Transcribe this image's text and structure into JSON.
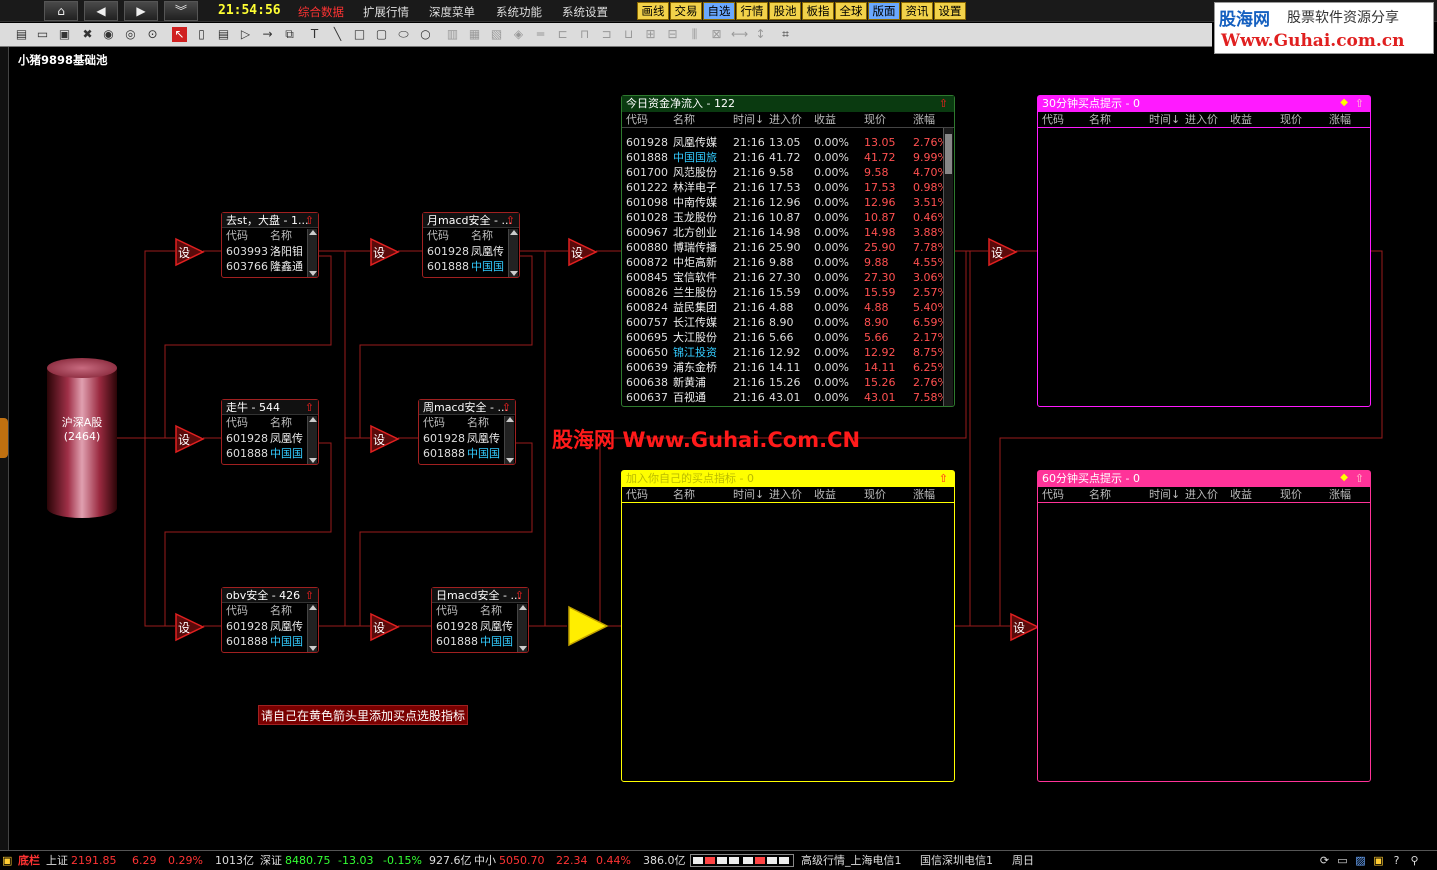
{
  "menubar": {
    "clock": "21:54:56",
    "items": [
      "综合数据",
      "扩展行情",
      "深度菜单",
      "系统功能",
      "系统设置"
    ],
    "quick": [
      "画线",
      "交易",
      "自选",
      "行情",
      "股池",
      "板指",
      "全球",
      "版面",
      "资讯",
      "设置"
    ]
  },
  "brand": {
    "line1": "股海网",
    "line1b": "股票软件资源分享",
    "line2": "Www.Guhai.com.cn"
  },
  "pool_title": "小猪9898基础池",
  "source": {
    "name": "沪深A股",
    "count": "(2464)"
  },
  "arrow_label": "设",
  "colors": {
    "wire": "#9a1c1c",
    "arrow": "#c41a1a",
    "arrow_yellow": "#ffee00",
    "panel_green_bg": "#0a3a10",
    "panel_green_border": "#2e7a2e",
    "panel_yellow": "#ffff00",
    "panel_magenta": "#ff1aff",
    "panel_pink": "#ff3399",
    "name_normal": "#eeeeee",
    "name_highlight": "#33ccff"
  },
  "filters": {
    "f1": {
      "title": "去st，大盘 - 1...",
      "cols": [
        "代码",
        "名称"
      ],
      "rows": [
        {
          "code": "603993",
          "name": "洛阳钼",
          "hl": false
        },
        {
          "code": "603766",
          "name": "隆鑫通",
          "hl": false
        }
      ]
    },
    "f2": {
      "title": "走牛 - 544",
      "cols": [
        "代码",
        "名称"
      ],
      "rows": [
        {
          "code": "601928",
          "name": "凤凰传",
          "hl": false
        },
        {
          "code": "601888",
          "name": "中国国",
          "hl": true
        }
      ]
    },
    "f3": {
      "title": "obv安全 - 426",
      "cols": [
        "代码",
        "名称"
      ],
      "rows": [
        {
          "code": "601928",
          "name": "凤凰传",
          "hl": false
        },
        {
          "code": "601888",
          "name": "中国国",
          "hl": true
        }
      ]
    },
    "f4": {
      "title": "月macd安全 - ...",
      "cols": [
        "代码",
        "名称"
      ],
      "rows": [
        {
          "code": "601928",
          "name": "凤凰传",
          "hl": false
        },
        {
          "code": "601888",
          "name": "中国国",
          "hl": true
        }
      ]
    },
    "f5": {
      "title": "周macd安全 - ...",
      "cols": [
        "代码",
        "名称"
      ],
      "rows": [
        {
          "code": "601928",
          "name": "凤凰传",
          "hl": false
        },
        {
          "code": "601888",
          "name": "中国国",
          "hl": true
        }
      ]
    },
    "f6": {
      "title": "日macd安全 - ...",
      "cols": [
        "代码",
        "名称"
      ],
      "rows": [
        {
          "code": "601928",
          "name": "凤凰传",
          "hl": false
        },
        {
          "code": "601888",
          "name": "中国国",
          "hl": true
        }
      ]
    }
  },
  "panel_cols": [
    "代码",
    "名称",
    "时间↓",
    "进入价",
    "收益",
    "现价",
    "涨幅"
  ],
  "panels": {
    "inflow": {
      "title": "今日资金净流入 - 122",
      "rows": [
        {
          "code": "601928",
          "name": "凤凰传媒",
          "time": "21:16",
          "in": "13.05",
          "ret": "0.00%",
          "now": "13.05",
          "chg": "2.76%",
          "hl": false
        },
        {
          "code": "601888",
          "name": "中国国旅",
          "time": "21:16",
          "in": "41.72",
          "ret": "0.00%",
          "now": "41.72",
          "chg": "9.99%",
          "hl": true
        },
        {
          "code": "601700",
          "name": "风范股份",
          "time": "21:16",
          "in": "9.58",
          "ret": "0.00%",
          "now": "9.58",
          "chg": "4.70%",
          "hl": false
        },
        {
          "code": "601222",
          "name": "林洋电子",
          "time": "21:16",
          "in": "17.53",
          "ret": "0.00%",
          "now": "17.53",
          "chg": "0.98%",
          "hl": false
        },
        {
          "code": "601098",
          "name": "中南传媒",
          "time": "21:16",
          "in": "12.96",
          "ret": "0.00%",
          "now": "12.96",
          "chg": "3.51%",
          "hl": false
        },
        {
          "code": "601028",
          "name": "玉龙股份",
          "time": "21:16",
          "in": "10.87",
          "ret": "0.00%",
          "now": "10.87",
          "chg": "0.46%",
          "hl": false
        },
        {
          "code": "600967",
          "name": "北方创业",
          "time": "21:16",
          "in": "14.98",
          "ret": "0.00%",
          "now": "14.98",
          "chg": "3.88%",
          "hl": false
        },
        {
          "code": "600880",
          "name": "博瑞传播",
          "time": "21:16",
          "in": "25.90",
          "ret": "0.00%",
          "now": "25.90",
          "chg": "7.78%",
          "hl": false
        },
        {
          "code": "600872",
          "name": "中炬高新",
          "time": "21:16",
          "in": "9.88",
          "ret": "0.00%",
          "now": "9.88",
          "chg": "4.55%",
          "hl": false
        },
        {
          "code": "600845",
          "name": "宝信软件",
          "time": "21:16",
          "in": "27.30",
          "ret": "0.00%",
          "now": "27.30",
          "chg": "3.06%",
          "hl": false
        },
        {
          "code": "600826",
          "name": "兰生股份",
          "time": "21:16",
          "in": "15.59",
          "ret": "0.00%",
          "now": "15.59",
          "chg": "2.57%",
          "hl": false
        },
        {
          "code": "600824",
          "name": "益民集团",
          "time": "21:16",
          "in": "4.88",
          "ret": "0.00%",
          "now": "4.88",
          "chg": "5.40%",
          "hl": false
        },
        {
          "code": "600757",
          "name": "长江传媒",
          "time": "21:16",
          "in": "8.90",
          "ret": "0.00%",
          "now": "8.90",
          "chg": "6.59%",
          "hl": false
        },
        {
          "code": "600695",
          "name": "大江股份",
          "time": "21:16",
          "in": "5.66",
          "ret": "0.00%",
          "now": "5.66",
          "chg": "2.17%",
          "hl": false
        },
        {
          "code": "600650",
          "name": "锦江投资",
          "time": "21:16",
          "in": "12.92",
          "ret": "0.00%",
          "now": "12.92",
          "chg": "8.75%",
          "hl": true
        },
        {
          "code": "600639",
          "name": "浦东金桥",
          "time": "21:16",
          "in": "14.11",
          "ret": "0.00%",
          "now": "14.11",
          "chg": "6.25%",
          "hl": false
        },
        {
          "code": "600638",
          "name": "新黄浦",
          "time": "21:16",
          "in": "15.26",
          "ret": "0.00%",
          "now": "15.26",
          "chg": "2.76%",
          "hl": false
        },
        {
          "code": "600637",
          "name": "百视通",
          "time": "21:16",
          "in": "43.01",
          "ret": "0.00%",
          "now": "43.01",
          "chg": "7.58%",
          "hl": false
        }
      ]
    },
    "buy": {
      "title": "加入你自己的买点指标 - 0"
    },
    "m30": {
      "title": "30分钟买点提示 - 0"
    },
    "m60": {
      "title": "60分钟买点提示 - 0"
    }
  },
  "hint": "请自己在黄色箭头里添加买点选股指标",
  "watermark": {
    "part1": "股海网",
    "part2": "Www.Guhai.Com.CN"
  },
  "statusbar": {
    "tag": "底栏",
    "sh_label": "上证",
    "sh_val": "2191.85",
    "sh_chg": "6.29",
    "sh_pct": "0.29%",
    "sh_amt": "1013亿",
    "sz_label": "深证",
    "sz_val": "8480.75",
    "sz_chg": "-13.03",
    "sz_pct": "-0.15%",
    "sz_amt": "927.6亿",
    "zx_label": "中小",
    "zx_val": "5050.70",
    "zx_chg": "22.34",
    "zx_pct": "0.44%",
    "zx_amt": "386.0亿",
    "server1": "高级行情_上海电信1",
    "server2": "国信深圳电信1",
    "day": "周日"
  }
}
